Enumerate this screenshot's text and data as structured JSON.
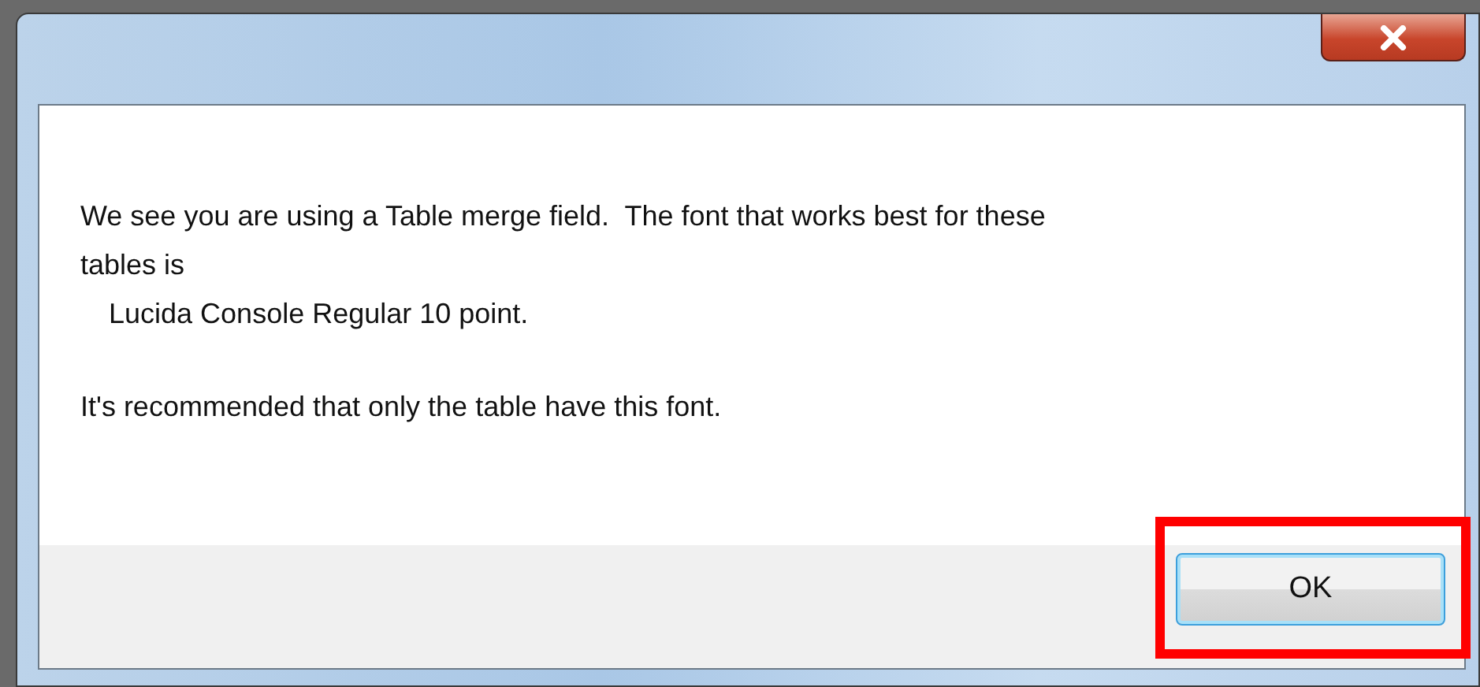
{
  "dialog": {
    "close_button": {
      "kind": "close"
    },
    "message_lines": [
      {
        "text": "We see you are using a Table merge field.  The font that works best for these",
        "kind": "plain"
      },
      {
        "text": "tables is",
        "kind": "plain"
      },
      {
        "text": "Lucida Console Regular 10 point.",
        "kind": "indented"
      },
      {
        "text": "It's recommended that only the table have this font.",
        "kind": "spaced"
      }
    ],
    "buttons": [
      {
        "label": "OK",
        "focused": true,
        "highlighted": true
      }
    ]
  }
}
